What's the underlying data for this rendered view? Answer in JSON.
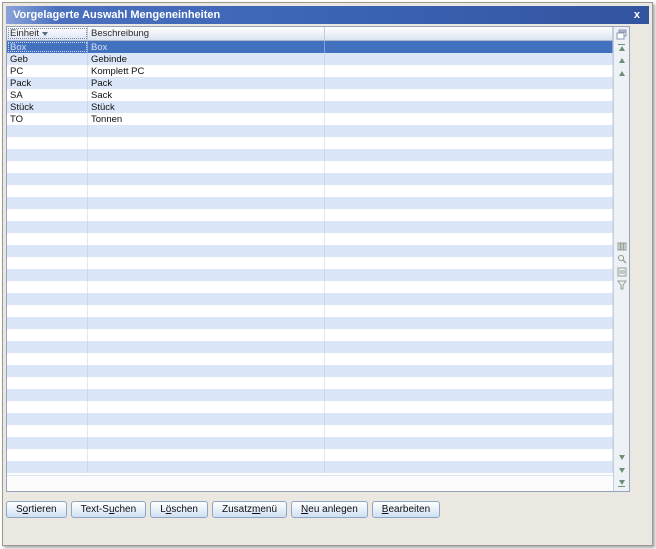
{
  "window": {
    "title": "Vorgelagerte Auswahl Mengeneinheiten",
    "close_glyph": "x"
  },
  "colors": {
    "titlebar_blue": "#3a63b4",
    "selected_row": "#4271bf",
    "alt_row": "#dbe7f8",
    "button_face": "#cfe0f3",
    "button_border": "#8da6c6"
  },
  "table": {
    "columns": [
      {
        "label": "Einheit",
        "sorted": true,
        "focused": true
      },
      {
        "label": "Beschreibung",
        "sorted": false,
        "focused": false
      }
    ],
    "rows": [
      {
        "einheit": "Box",
        "beschreibung": "Box",
        "selected": true
      },
      {
        "einheit": "Geb",
        "beschreibung": "Gebinde",
        "selected": false
      },
      {
        "einheit": "PC",
        "beschreibung": "Komplett PC",
        "selected": false
      },
      {
        "einheit": "Pack",
        "beschreibung": "Pack",
        "selected": false
      },
      {
        "einheit": "SA",
        "beschreibung": "Sack",
        "selected": false
      },
      {
        "einheit": "Stück",
        "beschreibung": "Stück",
        "selected": false
      },
      {
        "einheit": "TO",
        "beschreibung": "Tonnen",
        "selected": false
      }
    ],
    "empty_row_count": 29
  },
  "side_toolbar": {
    "icons": [
      "overlapping-windows-icon",
      "scroll-to-top-icon",
      "scroll-up-icon",
      "page-up-icon",
      "grid-columns-icon",
      "search-icon",
      "goto-record-icon",
      "filter-icon",
      "scroll-down-icon",
      "page-down-icon",
      "scroll-to-bottom-icon"
    ]
  },
  "buttons": [
    {
      "label": "Sortieren",
      "hotkey_index": 1
    },
    {
      "label": "Text-Suchen",
      "hotkey_index": 6
    },
    {
      "label": "Löschen",
      "hotkey_index": 1
    },
    {
      "label": "Zusatzmenü",
      "hotkey_index": 6
    },
    {
      "label": "Neu anlegen",
      "hotkey_index": 0
    },
    {
      "label": "Bearbeiten",
      "hotkey_index": 0
    }
  ]
}
